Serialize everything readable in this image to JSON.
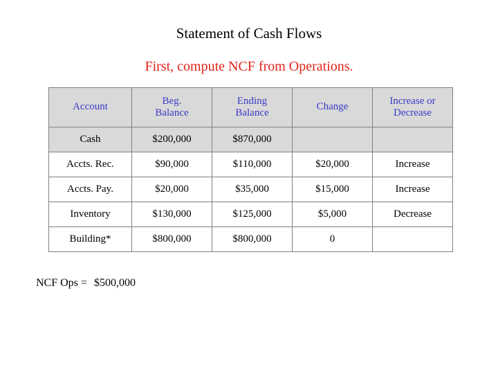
{
  "slide": {
    "title": "Statement of Cash Flows",
    "subtitle": "First, compute NCF from Operations.",
    "subtitle_color": "#e2231a",
    "header_text_color": "#3a3ac8",
    "header_fill": "#d9d9d9"
  },
  "table": {
    "columns": [
      {
        "line1": "Account",
        "line2": ""
      },
      {
        "line1": "Beg.",
        "line2": "Balance"
      },
      {
        "line1": "Ending",
        "line2": "Balance"
      },
      {
        "line1": "Change",
        "line2": ""
      },
      {
        "line1": "Increase or",
        "line2": "Decrease"
      }
    ],
    "rows": [
      {
        "shaded": true,
        "cells": [
          "Cash",
          "$200,000",
          "$870,000",
          "",
          ""
        ]
      },
      {
        "shaded": false,
        "cells": [
          "Accts. Rec.",
          "$90,000",
          "$110,000",
          "$20,000",
          "Increase"
        ]
      },
      {
        "shaded": false,
        "cells": [
          "Accts. Pay.",
          "$20,000",
          "$35,000",
          "$15,000",
          "Increase"
        ]
      },
      {
        "shaded": false,
        "cells": [
          "Inventory",
          "$130,000",
          "$125,000",
          "$5,000",
          "Decrease"
        ]
      },
      {
        "shaded": false,
        "cells": [
          "Building*",
          "$800,000",
          "$800,000",
          "0",
          ""
        ]
      }
    ]
  },
  "footer": {
    "ncf_label": "NCF Ops =",
    "ncf_value": "$500,000"
  }
}
